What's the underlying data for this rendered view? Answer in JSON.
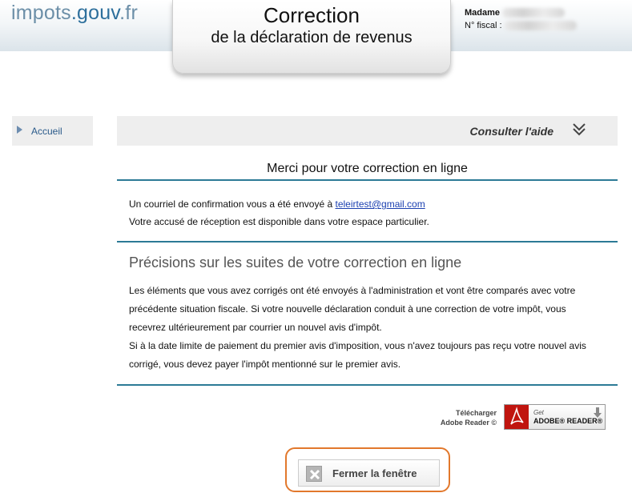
{
  "header": {
    "logo_part1": "impots",
    "logo_part2": ".gouv",
    "logo_part3": ".fr",
    "title_line1": "Correction",
    "title_line2": "de la déclaration de revenus",
    "user_title": "Madame",
    "fiscal_label": "N° fiscal :"
  },
  "sidebar": {
    "items": [
      {
        "label": "Accueil"
      }
    ]
  },
  "help": {
    "label": "Consulter l'aide",
    "icon": "double-chevron-down-icon"
  },
  "confirmation": {
    "title": "Merci pour votre correction en ligne",
    "email_prefix": "Un courriel de confirmation vous a été envoyé à ",
    "email": "teleirtest@gmail.com",
    "receipt_text": "Votre accusé de réception est disponible dans votre espace particulier."
  },
  "details": {
    "title": "Précisions sur les suites de votre correction en ligne",
    "line1": "Les éléments que vous avez corrigés ont été envoyés à l'administration et vont être comparés avec votre",
    "line2": "précédente situation fiscale. Si votre nouvelle déclaration conduit à une correction de votre impôt, vous",
    "line3": "recevrez ultérieurement par courrier un nouvel avis d'impôt.",
    "line4": "Si à la date limite de paiement du premier avis d'imposition, vous n'avez toujours pas reçu votre nouvel avis",
    "line5": "corrigé, vous devez payer l'impôt mentionné sur le premier avis."
  },
  "adobe": {
    "caption_line1": "Télécharger",
    "caption_line2": "Adobe Reader ©",
    "badge_get": "Get",
    "badge_reader": "ADOBE® READER®"
  },
  "close": {
    "label": "Fermer la fenêtre"
  },
  "colors": {
    "rule": "#2c7a96",
    "close_frame": "#e2782c",
    "link": "#1a3fb0",
    "adobe_red": "#c0150f"
  }
}
